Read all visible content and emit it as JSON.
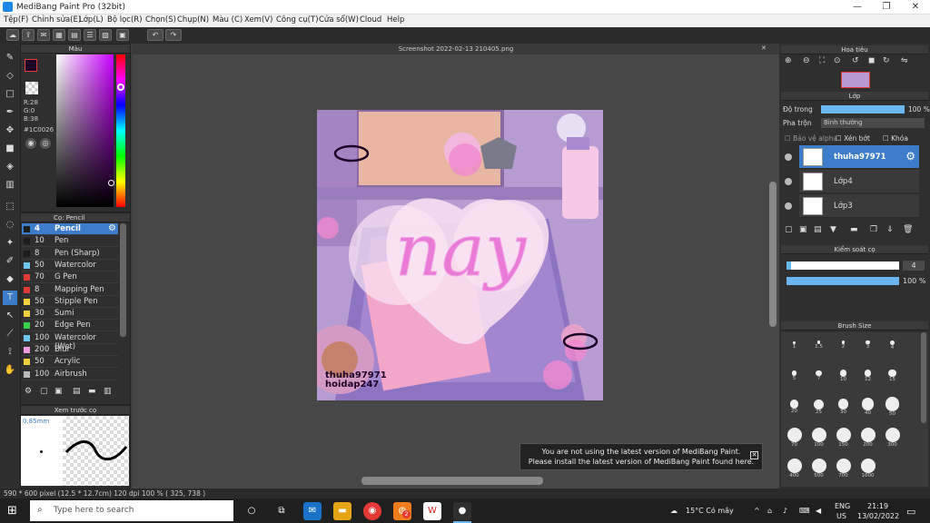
{
  "window": {
    "title": "MediBang Paint Pro (32bit)",
    "minimize": "—",
    "maximize": "❐",
    "close": "✕"
  },
  "menu": [
    "Tệp(F)",
    "Chỉnh sửa(E)",
    "Lớp(L)",
    "Bộ lọc(R)",
    "Chọn(S)",
    "Chụp(N)",
    "Màu (C)",
    "Xem(V)",
    "Công cụ(T)",
    "Cửa sổ(W)",
    "Cloud",
    "Help"
  ],
  "color_panel": {
    "title": "Màu",
    "r": "R:28",
    "g": "G:0",
    "b": "B:38",
    "hex": "#1C0026",
    "fg": "#1c0026",
    "bg": "#4a9eff"
  },
  "brush_panel": {
    "title": "Cọ: Pencil",
    "items": [
      {
        "size": "4",
        "name": "Pencil",
        "color": "#1c1c1c"
      },
      {
        "size": "10",
        "name": "Pen",
        "color": "#1c1c1c"
      },
      {
        "size": "8",
        "name": "Pen (Sharp)",
        "color": "#1c1c1c"
      },
      {
        "size": "50",
        "name": "Watercolor",
        "color": "#6fc6f2"
      },
      {
        "size": "70",
        "name": "G Pen",
        "color": "#e53935"
      },
      {
        "size": "8",
        "name": "Mapping Pen",
        "color": "#e53935"
      },
      {
        "size": "50",
        "name": "Stipple Pen",
        "color": "#f2d13a"
      },
      {
        "size": "30",
        "name": "Sumi",
        "color": "#f2d13a"
      },
      {
        "size": "20",
        "name": "Edge Pen",
        "color": "#3ad14a"
      },
      {
        "size": "100",
        "name": "Watercolor (Wet)",
        "color": "#6fc6f2"
      },
      {
        "size": "200",
        "name": "Blur",
        "color": "#f29ae0"
      },
      {
        "size": "50",
        "name": "Acrylic",
        "color": "#f2d13a"
      },
      {
        "size": "100",
        "name": "Airbrush",
        "color": "#bbbbbb"
      }
    ]
  },
  "preview_panel": {
    "title": "Xem trước cọ",
    "size": "0.85mm"
  },
  "document": {
    "tab": "Screenshot 2022-02-13 210405.png",
    "art_text": "nay",
    "watermark_1": "thuha97971",
    "watermark_2": "hoidap247"
  },
  "notice": {
    "line1": "You are not using the latest version of MediBang Paint.",
    "line2": "Please install the latest version of MediBang Paint found here."
  },
  "navigator": {
    "title": "Hoa tiêu"
  },
  "layer_panel": {
    "title": "Lớp",
    "opacity_label": "Độ trong",
    "opacity_value": "100 %",
    "opacity": 100,
    "blend_label": "Pha trộn",
    "blend_value": "Bình thường",
    "protect_alpha": "Bảo vệ alpha",
    "clipping": "Xén bớt",
    "lock": "Khóa",
    "layers": [
      {
        "name": "thuha97971"
      },
      {
        "name": "Lớp4"
      },
      {
        "name": "Lớp3"
      }
    ]
  },
  "brush_control": {
    "title": "Kiểm soát cọ",
    "size_value": "4",
    "opacity_value": "100 %",
    "size_fraction": 0.04,
    "opacity_fraction": 1.0
  },
  "brush_size": {
    "title": "Brush Size",
    "sizes": [
      "1",
      "1.5",
      "2",
      "3",
      "4",
      "5",
      "7",
      "10",
      "12",
      "15",
      "20",
      "25",
      "30",
      "40",
      "50",
      "70",
      "100",
      "150",
      "200",
      "300",
      "400",
      "500",
      "700",
      "1000"
    ]
  },
  "statusbar": {
    "text": "590 * 600 pixel   (12.5 * 12.7cm)   120 dpi   100 %   ( 325, 738 )"
  },
  "taskbar": {
    "search_placeholder": "Type here to search",
    "weather": "15°C  Có mây",
    "lang1": "ENG",
    "lang2": "US",
    "time": "21:19",
    "date": "13/02/2022",
    "notif": "2"
  }
}
